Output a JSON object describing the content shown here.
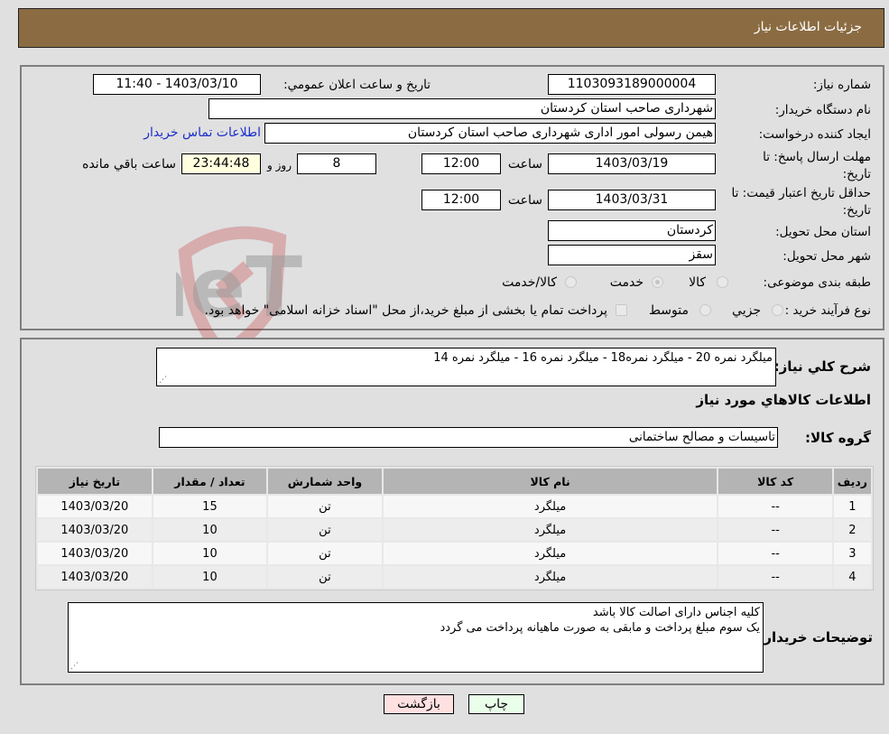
{
  "header": {
    "title": "جزئیات اطلاعات نیاز"
  },
  "form": {
    "need_number": {
      "label": "شماره نیاز:",
      "value": "1103093189000004"
    },
    "announce_datetime": {
      "label": "تاریخ و ساعت اعلان عمومي:",
      "value": "1403/03/10 - 11:40"
    },
    "buyer_org": {
      "label": "نام دستگاه خریدار:",
      "value": "شهرداری صاحب استان کردستان"
    },
    "requester": {
      "label": "ایجاد کننده درخواست:",
      "value": "هیمن رسولی امور اداری شهرداری صاحب استان کردستان"
    },
    "buyer_contact_link": "اطلاعات تماس خریدار",
    "response_deadline": {
      "label": "مهلت ارسال پاسخ: تا تاریخ:",
      "date": "1403/03/19",
      "time_label": "ساعت",
      "time": "12:00",
      "days": "8",
      "days_label": "روز و",
      "remaining": "23:44:48",
      "remaining_label": "ساعت باقي مانده"
    },
    "price_validity": {
      "label": "حداقل تاریخ اعتبار قیمت: تا تاریخ:",
      "date": "1403/03/31",
      "time_label": "ساعت",
      "time": "12:00"
    },
    "delivery_province": {
      "label": "استان محل تحویل:",
      "value": "کردستان"
    },
    "delivery_city": {
      "label": "شهر محل تحویل:",
      "value": "سقز"
    },
    "category": {
      "label": "طبقه بندی موضوعی:",
      "options": [
        "کالا",
        "خدمت",
        "کالا/خدمت"
      ],
      "selected": "خدمت"
    },
    "purchase_type": {
      "label": "نوع فرآیند خرید :",
      "options": [
        "جزيي",
        "متوسط"
      ],
      "treasury_note": "پرداخت تمام یا بخشی از مبلغ خرید،از محل \"اسناد خزانه اسلامی\" خواهد بود."
    }
  },
  "details": {
    "general_desc_label": "شرح کلي نیاز:",
    "general_desc": "میلگرد نمره 20 - میلگرد نمره18 - میلگرد نمره 16 - میلگرد نمره 14",
    "goods_info_title": "اطلاعات کالاهاي مورد نیاز",
    "goods_group_label": "گروه کالا:",
    "goods_group": "تاسیسات و مصالح ساختمانی",
    "table": {
      "headers": [
        "ردیف",
        "کد کالا",
        "نام کالا",
        "واحد شمارش",
        "تعداد / مقدار",
        "تاریخ نیاز"
      ],
      "rows": [
        [
          "1",
          "--",
          "میلگرد",
          "تن",
          "15",
          "1403/03/20"
        ],
        [
          "2",
          "--",
          "میلگرد",
          "تن",
          "10",
          "1403/03/20"
        ],
        [
          "3",
          "--",
          "میلگرد",
          "تن",
          "10",
          "1403/03/20"
        ],
        [
          "4",
          "--",
          "میلگرد",
          "تن",
          "10",
          "1403/03/20"
        ]
      ]
    },
    "buyer_notes_label": "توضیحات خریدار:",
    "buyer_notes": [
      "کلیه اجناس دارای اصالت کالا باشد",
      "یک سوم مبلغ پرداخت و مابقی به صورت ماهیانه پرداخت می گردد"
    ]
  },
  "buttons": {
    "print": "چاپ",
    "back": "بازگشت"
  },
  "watermark": {
    "text": "AriaTender.neT"
  }
}
